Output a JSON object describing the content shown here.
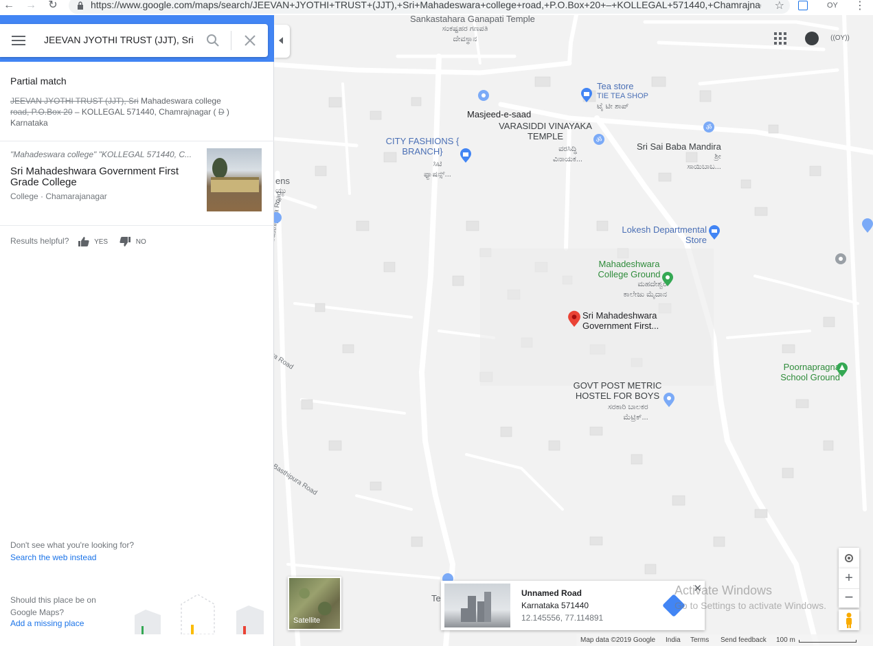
{
  "browser": {
    "url": "https://www.google.com/maps/search/JEEVAN+JYOTHI+TRUST+(JJT),+Sri+Mahadeswara+college+road,+P.O.Box+20+–+KOLLEGAL+571440,+Chamrajnag...",
    "ext_label": "OY"
  },
  "search": {
    "value": "JEEVAN JYOTHI TRUST (JJT), Sri"
  },
  "panel": {
    "partial_title": "Partial match",
    "partial_strike_1": "JEEVAN JYOTHI TRUST (JJT), Sri",
    "partial_text_1": "Mahadeswara college",
    "partial_strike_2": "road, P.O.Box 20",
    "partial_text_2": "– KOLLEGAL 571440, Chamrajnagar (",
    "partial_strike_3": "D",
    "partial_text_3": ")",
    "partial_text_4": "Karnataka",
    "result": {
      "query": "\"Mahadeswara college\" \"KOLLEGAL 571440, C...",
      "name": "Sri Mahadeshwara Government First Grade College",
      "meta": "College · Chamarajanagar"
    },
    "helpful_label": "Results helpful?",
    "helpful_yes": "YES",
    "helpful_no": "NO",
    "dont_see": "Don't see what you're looking for?",
    "search_web": "Search the web instead",
    "should_place": "Should this place be on Google Maps?",
    "add_place": "Add a missing place"
  },
  "map": {
    "account_label": "((OY))",
    "pois": {
      "ganapati": "Sankastahara Ganapati Temple",
      "ganapati_kn1": "ಸಂಕಷ್ಟಹರ ಗಣಪತಿ",
      "ganapati_kn2": "ದೇವಸ್ಥಾನ",
      "tea": "Tea store",
      "tea_sub": "TIE TEA SHOP",
      "tea_kn": "ಟೈ ಟೀ ಶಾಪ್",
      "masjeed": "Masjeed-e-saad",
      "varasiddi": "VARASIDDI VINAYAKA TEMPLE",
      "varasiddi_kn1": "ವರಸಿದ್ಧಿ",
      "varasiddi_kn2": "ವಿನಾಯಕ...",
      "city": "CITY FASHIONS { BRANCH}",
      "city_kn1": "ಸಿಟಿ",
      "city_kn2": "ಫ್ಯಾಷನ್ಸ್...",
      "saibaba": "Sri Sai Baba Mandira",
      "saibaba_kn1": "ಶ್ರೀ",
      "saibaba_kn2": "ಸಾಯಿಬಾಬ...",
      "lokesh": "Lokesh Departmental Store",
      "ground": "Mahadeshwara College Ground",
      "ground_kn1": "ಮಹದೇಶ್ವರ",
      "ground_kn2": "ಕಾಲೇಜು ಮೈದಾನ",
      "sri_mahadeshwara": "Sri Mahadeshwara Government First...",
      "poornapragna": "Poornapragna School Ground",
      "govt_post": "GOVT POST METRIC HOSTEL FOR BOYS",
      "govt_post_kn1": "ಸರಕಾರಿ ಬಾಲಕರ",
      "govt_post_kn2": "ಮೆಟ್ರಿಕ್...",
      "edge_ens": "ens",
      "edge_kn": "ಯ್ಯು",
      "edge_kn2": "ನ್",
      "edge_te": "Te"
    },
    "roads": {
      "basthipura_1": "Basthipura Road",
      "basthipura_2": "Basthipura Road",
      "ra_road": "ra Road"
    },
    "satellite_label": "Satellite",
    "info": {
      "title": "Unnamed Road",
      "region": "Karnataka 571440",
      "coords": "12.145556, 77.114891"
    },
    "watermark_1": "Activate Windows",
    "watermark_2": "Go to Settings to activate Windows.",
    "footer": {
      "mapdata": "Map data ©2019 Google",
      "india": "India",
      "terms": "Terms",
      "feedback": "Send feedback",
      "scale": "100 m"
    }
  }
}
